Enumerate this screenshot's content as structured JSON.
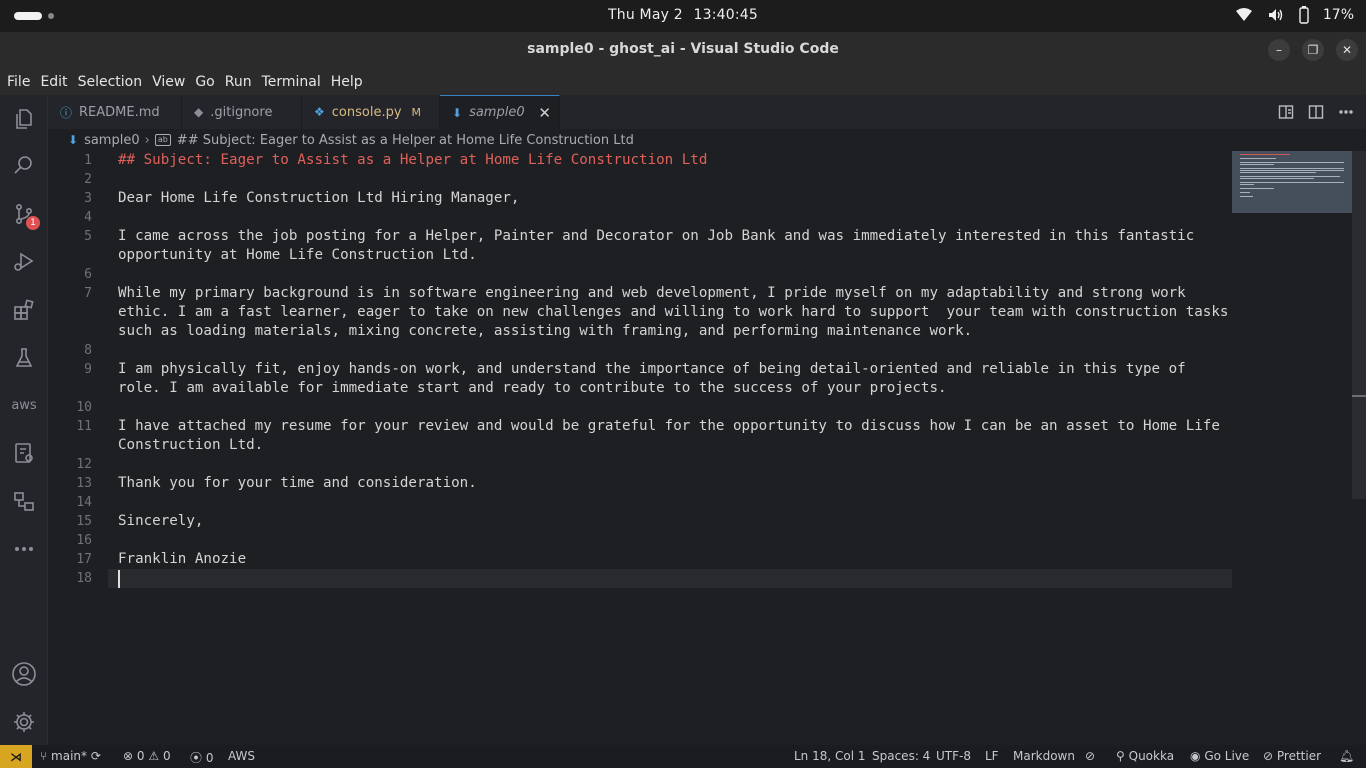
{
  "system": {
    "date": "Thu May 2",
    "time": "13:40:45",
    "battery": "17%"
  },
  "window": {
    "title": "sample0 - ghost_ai - Visual Studio Code"
  },
  "menu": [
    "File",
    "Edit",
    "Selection",
    "View",
    "Go",
    "Run",
    "Terminal",
    "Help"
  ],
  "activity": {
    "scm_badge": "1",
    "aws_label": "aws"
  },
  "tabs": [
    {
      "label": "README.md",
      "icon": "info-icon"
    },
    {
      "label": ".gitignore",
      "icon": "git-icon"
    },
    {
      "label": "console.py",
      "icon": "python-icon",
      "modified": "M"
    },
    {
      "label": "sample0",
      "icon": "download-icon",
      "active": true,
      "close": "✕"
    }
  ],
  "breadcrumb": {
    "file": "sample0",
    "symbol": "## Subject: Eager to Assist as a Helper at Home Life Construction Ltd"
  },
  "editor": {
    "lines": [
      {
        "n": "1",
        "text": "## Subject: Eager to Assist as a Helper at Home Life Construction Ltd",
        "heading": true
      },
      {
        "n": "2",
        "text": ""
      },
      {
        "n": "3",
        "text": "Dear Home Life Construction Ltd Hiring Manager,"
      },
      {
        "n": "4",
        "text": ""
      },
      {
        "n": "5",
        "text": "I came across the job posting for a Helper, Painter and Decorator on Job Bank and was immediately interested in this fantastic"
      },
      {
        "n": "",
        "text": "opportunity at Home Life Construction Ltd."
      },
      {
        "n": "6",
        "text": ""
      },
      {
        "n": "7",
        "text": "While my primary background is in software engineering and web development, I pride myself on my adaptability and strong work"
      },
      {
        "n": "",
        "text": "ethic. I am a fast learner, eager to take on new challenges and willing to work hard to support  your team with construction tasks"
      },
      {
        "n": "",
        "text": "such as loading materials, mixing concrete, assisting with framing, and performing maintenance work."
      },
      {
        "n": "8",
        "text": ""
      },
      {
        "n": "9",
        "text": "I am physically fit, enjoy hands-on work, and understand the importance of being detail-oriented and reliable in this type of"
      },
      {
        "n": "",
        "text": "role. I am available for immediate start and ready to contribute to the success of your projects."
      },
      {
        "n": "10",
        "text": ""
      },
      {
        "n": "11",
        "text": "I have attached my resume for your review and would be grateful for the opportunity to discuss how I can be an asset to Home Life"
      },
      {
        "n": "",
        "text": "Construction Ltd."
      },
      {
        "n": "12",
        "text": ""
      },
      {
        "n": "13",
        "text": "Thank you for your time and consideration."
      },
      {
        "n": "14",
        "text": ""
      },
      {
        "n": "15",
        "text": "Sincerely,"
      },
      {
        "n": "16",
        "text": ""
      },
      {
        "n": "17",
        "text": "Franklin Anozie"
      },
      {
        "n": "18",
        "text": ""
      }
    ]
  },
  "status": {
    "branch": "main*",
    "errors": "0",
    "warnings": "0",
    "ports": "0",
    "aws": "AWS",
    "position": "Ln 18, Col 1",
    "spaces": "Spaces: 4",
    "encoding": "UTF-8",
    "eol": "LF",
    "language": "Markdown",
    "quokka": "Quokka",
    "golive": "Go Live",
    "prettier": "Prettier"
  },
  "colors": {
    "heading": "#e0605a",
    "remote_badge": "#d8a520",
    "scm_badge": "#e05252"
  }
}
